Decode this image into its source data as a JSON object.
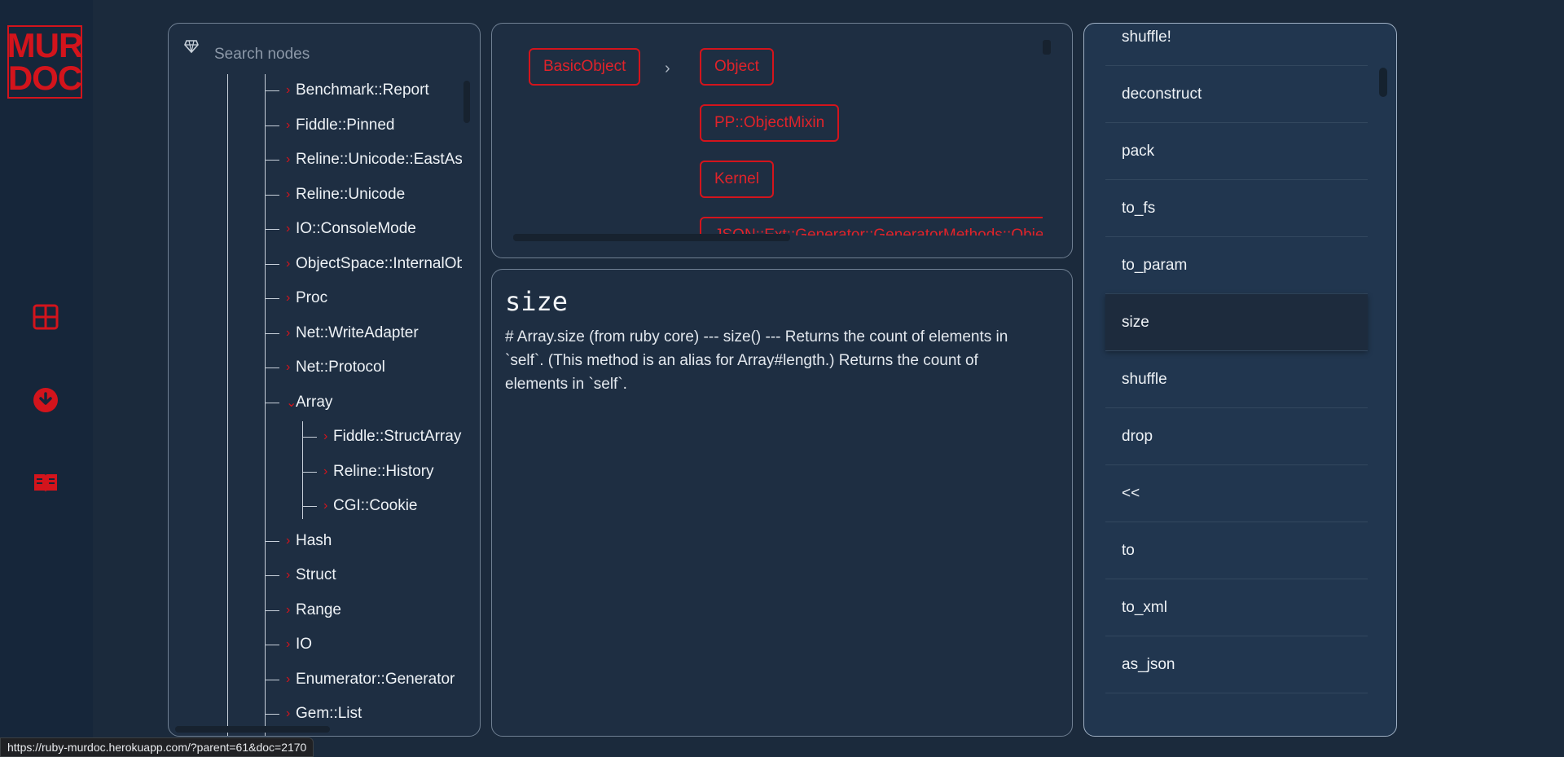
{
  "logo": {
    "line1": "MUR",
    "line2": "DOC"
  },
  "rail": {
    "icons": [
      "grid-icon",
      "download-icon",
      "book-icon"
    ]
  },
  "colors": {
    "accent": "#d3141c",
    "background": "#1b2a3c",
    "panel": "#1e2e42"
  },
  "search": {
    "placeholder": "Search nodes",
    "value": ""
  },
  "tree": {
    "nodes": [
      {
        "label": "Benchmark::Report",
        "chev": "›"
      },
      {
        "label": "Fiddle::Pinned",
        "chev": "›"
      },
      {
        "label": "Reline::Unicode::EastAsianWidth",
        "chev": "›"
      },
      {
        "label": "Reline::Unicode",
        "chev": "›"
      },
      {
        "label": "IO::ConsoleMode",
        "chev": "›"
      },
      {
        "label": "ObjectSpace::InternalObjectWrapper",
        "chev": "›"
      },
      {
        "label": "Proc",
        "chev": "›"
      },
      {
        "label": "Net::WriteAdapter",
        "chev": "›"
      },
      {
        "label": "Net::Protocol",
        "chev": "›"
      },
      {
        "label": "Array",
        "chev": "⌄"
      },
      {
        "label": "Fiddle::StructArray",
        "chev": "›"
      },
      {
        "label": "Reline::History",
        "chev": "›"
      },
      {
        "label": "CGI::Cookie",
        "chev": "›"
      },
      {
        "label": "Hash",
        "chev": "›"
      },
      {
        "label": "Struct",
        "chev": "›"
      },
      {
        "label": "Range",
        "chev": "›"
      },
      {
        "label": "IO",
        "chev": "›"
      },
      {
        "label": "Enumerator::Generator",
        "chev": "›"
      },
      {
        "label": "Gem::List",
        "chev": "›"
      }
    ]
  },
  "ancestry": {
    "root": "BasicObject",
    "arrow": "›",
    "chain": [
      "Object",
      "PP::ObjectMixin",
      "Kernel",
      "JSON::Ext::Generator::GeneratorMethods::Object"
    ]
  },
  "doc": {
    "title": "size",
    "body": "# Array.size (from ruby core) --- size() --- Returns the count of elements in `self`. (This method is an alias for Array#length.) Returns the count of elements in `self`."
  },
  "methods": {
    "items": [
      "shuffle!",
      "deconstruct",
      "pack",
      "to_fs",
      "to_param",
      "size",
      "shuffle",
      "drop",
      "<<",
      "to",
      "to_xml",
      "as_json"
    ],
    "active": "size"
  },
  "status": {
    "url": "https://ruby-murdoc.herokuapp.com/?parent=61&doc=2170"
  }
}
